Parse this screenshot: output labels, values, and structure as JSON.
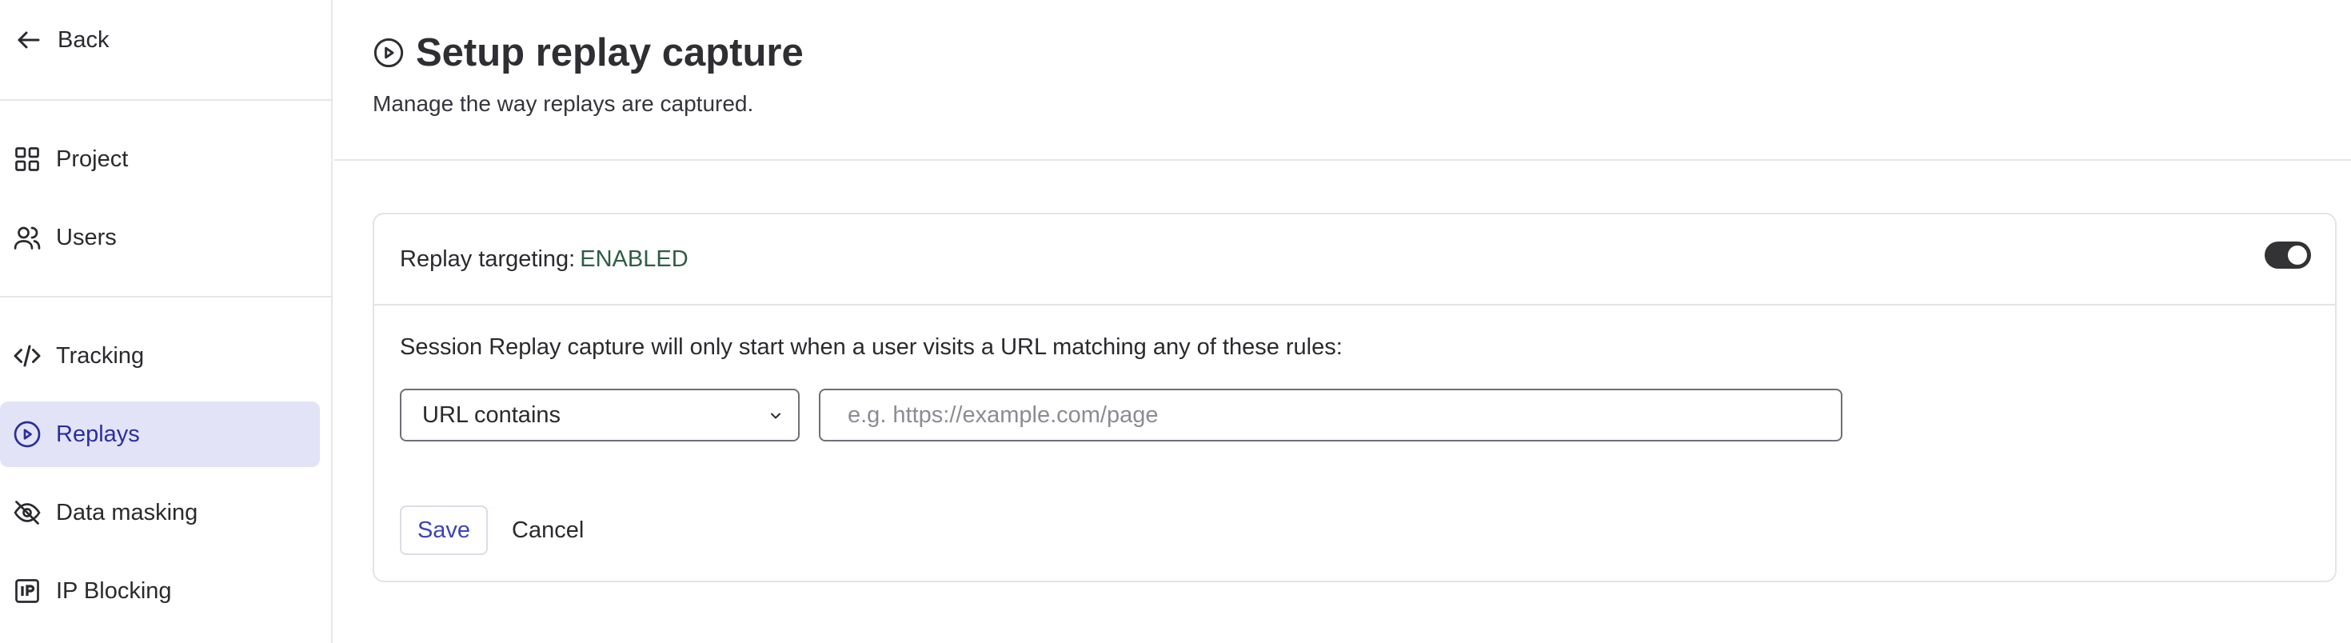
{
  "sidebar": {
    "back_label": "Back",
    "items": [
      {
        "label": "Project",
        "icon": "grid-icon",
        "active": false
      },
      {
        "label": "Users",
        "icon": "users-icon",
        "active": false
      },
      {
        "label": "Tracking",
        "icon": "code-icon",
        "active": false
      },
      {
        "label": "Replays",
        "icon": "play-circle-icon",
        "active": true
      },
      {
        "label": "Data masking",
        "icon": "eye-off-icon",
        "active": false
      },
      {
        "label": "IP Blocking",
        "icon": "ip-icon",
        "active": false
      }
    ]
  },
  "header": {
    "title": "Setup replay capture",
    "subtitle": "Manage the way replays are captured."
  },
  "card": {
    "targeting_label": "Replay targeting:",
    "targeting_state": "ENABLED",
    "toggle_on": true,
    "rule_text": "Session Replay capture will only start when a user visits a URL matching any of these rules:",
    "condition_select": "URL contains",
    "url_value": "",
    "url_placeholder": "e.g. https://example.com/page",
    "save_label": "Save",
    "cancel_label": "Cancel"
  },
  "colors": {
    "active_bg": "#e3e3f8",
    "active_text": "#2a2f9e",
    "enabled_text": "#2e5d45",
    "save_text": "#3d44b5"
  }
}
